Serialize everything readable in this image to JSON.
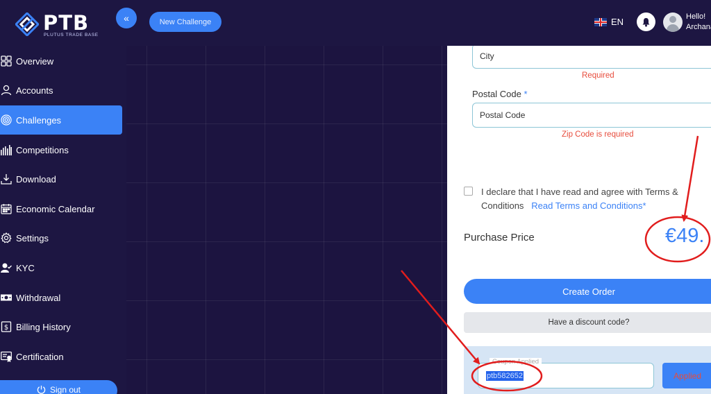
{
  "header": {
    "logo_text": "PTB",
    "logo_subtitle": "PLUTUS TRADE BASE",
    "new_challenge_label": "New Challenge",
    "language": "EN",
    "greeting": "Hello!",
    "username": "Archana"
  },
  "sidebar": {
    "items": [
      {
        "label": "Overview",
        "icon": "grid-icon"
      },
      {
        "label": "Accounts",
        "icon": "user-icon"
      },
      {
        "label": "Challenges",
        "icon": "target-icon",
        "active": true
      },
      {
        "label": "Competitions",
        "icon": "bars-icon"
      },
      {
        "label": "Download",
        "icon": "download-icon"
      },
      {
        "label": "Economic Calendar",
        "icon": "calendar-icon"
      },
      {
        "label": "Settings",
        "icon": "gear-icon"
      },
      {
        "label": "KYC",
        "icon": "user-check-icon"
      },
      {
        "label": "Withdrawal",
        "icon": "money-icon"
      },
      {
        "label": "Billing History",
        "icon": "dollar-doc-icon"
      },
      {
        "label": "Certification",
        "icon": "certificate-icon"
      }
    ],
    "signout_label": "Sign out"
  },
  "form": {
    "city_placeholder": "City",
    "city_error": "Required",
    "postal_label": "Postal Code",
    "postal_required_mark": "*",
    "postal_placeholder": "Postal Code",
    "postal_error": "Zip Code is required",
    "declare_text": "I declare that I have read and agree with Terms & Conditions",
    "terms_link": "Read Terms and Conditions*",
    "purchase_price_label": "Purchase Price",
    "purchase_price_value": "€49.",
    "create_order_label": "Create Order",
    "discount_label": "Have a discount code?",
    "coupon_legend": "Coupon Applied",
    "coupon_value": "ptb582652",
    "applied_label": "Applied"
  },
  "colors": {
    "accent": "#3b82f6",
    "background": "#1c1440",
    "error": "#e74c3c",
    "annotation": "#e11d1d"
  }
}
